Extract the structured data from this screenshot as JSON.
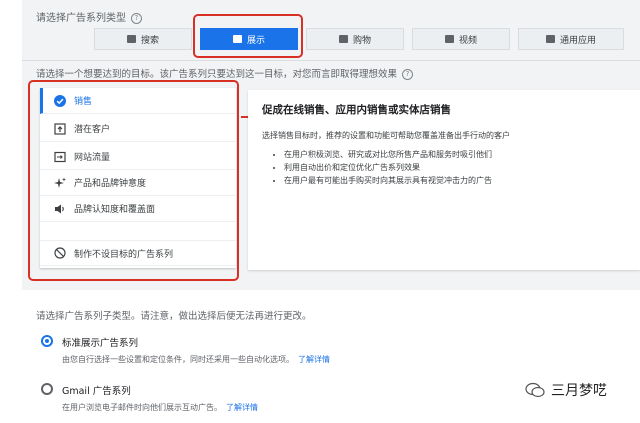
{
  "section_campaign_type": {
    "label": "请选择广告系列类型",
    "tabs": [
      {
        "label": "搜索",
        "icon": "search-icon",
        "selected": false
      },
      {
        "label": "展示",
        "icon": "display-icon",
        "selected": true
      },
      {
        "label": "购物",
        "icon": "shopping-icon",
        "selected": false
      },
      {
        "label": "视频",
        "icon": "video-icon",
        "selected": false
      },
      {
        "label": "通用应用",
        "icon": "app-icon",
        "selected": false
      }
    ]
  },
  "section_goal": {
    "label": "请选择一个想要达到的目标。该广告系列只要达到这一目标，对您而言即取得理想效果",
    "goals": [
      {
        "label": "销售",
        "icon": "check-circle-icon",
        "selected": true
      },
      {
        "label": "潜在客户",
        "icon": "leads-icon",
        "selected": false
      },
      {
        "label": "网站流量",
        "icon": "traffic-icon",
        "selected": false
      },
      {
        "label": "产品和品牌钟意度",
        "icon": "sparkle-icon",
        "selected": false
      },
      {
        "label": "品牌认知度和覆盖面",
        "icon": "speaker-icon",
        "selected": false
      },
      {
        "label": "制作不设目标的广告系列",
        "icon": "no-goal-icon",
        "selected": false
      }
    ],
    "detail": {
      "title": "促成在线销售、应用内销售或实体店销售",
      "desc": "选择销售目标时，推荐的设置和功能可帮助您覆盖准备出手行动的客户",
      "bullets": [
        "在用户积极浏览、研究或对比您所售产品和服务时吸引他们",
        "利用自动出价和定位优化广告系列效果",
        "在用户最有可能出手购买时向其展示具有视觉冲击力的广告"
      ]
    }
  },
  "section_subtype": {
    "label": "请选择广告系列子类型。请注意，做出选择后便无法再进行更改。",
    "options": [
      {
        "label": "标准展示广告系列",
        "desc": "由您自行选择一些设置和定位条件，同时还采用一些自动化选项。",
        "link": "了解详情",
        "selected": true
      },
      {
        "label": "Gmail 广告系列",
        "desc": "在用户浏览电子邮件时向他们展示互动广告。",
        "link": "了解详情",
        "selected": false
      }
    ]
  },
  "watermark": {
    "text": "三月梦呓"
  },
  "colors": {
    "accent": "#1a73e8",
    "highlight": "#d93025"
  }
}
